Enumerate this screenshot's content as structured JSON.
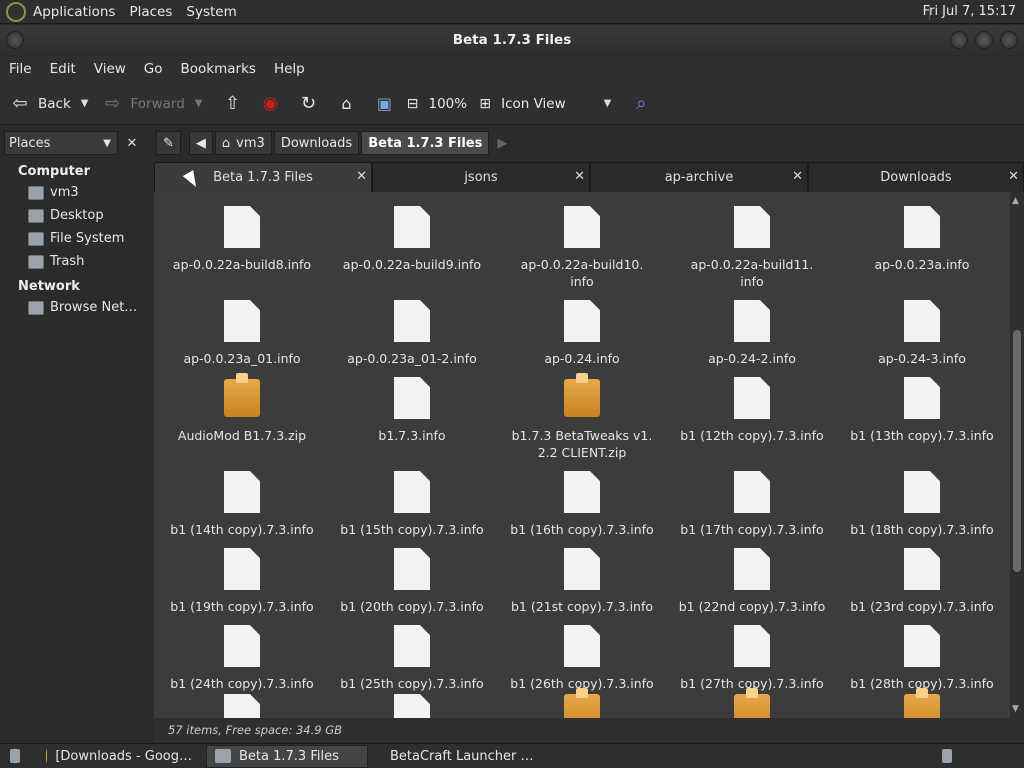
{
  "topbar": {
    "menus": [
      "Applications",
      "Places",
      "System"
    ],
    "clock": "Fri Jul  7, 15:17"
  },
  "window": {
    "title": "Beta 1.7.3 Files"
  },
  "menubar": [
    "File",
    "Edit",
    "View",
    "Go",
    "Bookmarks",
    "Help"
  ],
  "toolbar": {
    "back": "Back",
    "forward": "Forward",
    "zoom": "100%",
    "view_mode": "Icon View"
  },
  "sidebar": {
    "selector": "Places",
    "groups": [
      {
        "label": "Computer",
        "items": [
          "vm3",
          "Desktop",
          "File System",
          "Trash"
        ]
      },
      {
        "label": "Network",
        "items": [
          "Browse Net…"
        ]
      }
    ]
  },
  "pathbar": [
    "vm3",
    "Downloads",
    "Beta 1.7.3 Files"
  ],
  "tabs": [
    "Beta 1.7.3 Files",
    "jsons",
    "ap-archive",
    "Downloads"
  ],
  "files": [
    [
      "ap-0.0.22a-build8.info",
      "file"
    ],
    [
      "ap-0.0.22a-build9.info",
      "file"
    ],
    [
      "ap-0.0.22a-build10.\ninfo",
      "file"
    ],
    [
      "ap-0.0.22a-build11.\ninfo",
      "file"
    ],
    [
      "ap-0.0.23a.info",
      "file"
    ],
    [
      "ap-0.0.23a_01.info",
      "file"
    ],
    [
      "ap-0.0.23a_01-2.info",
      "file"
    ],
    [
      "ap-0.24.info",
      "file"
    ],
    [
      "ap-0.24-2.info",
      "file"
    ],
    [
      "ap-0.24-3.info",
      "file"
    ],
    [
      "AudioMod B1.7.3.zip",
      "zip"
    ],
    [
      "b1.7.3.info",
      "file"
    ],
    [
      "b1.7.3 BetaTweaks v1.\n2.2 CLIENT.zip",
      "zip"
    ],
    [
      "b1 (12th copy).7.3.info",
      "file"
    ],
    [
      "b1 (13th copy).7.3.info",
      "file"
    ],
    [
      "b1 (14th copy).7.3.info",
      "file"
    ],
    [
      "b1 (15th copy).7.3.info",
      "file"
    ],
    [
      "b1 (16th copy).7.3.info",
      "file"
    ],
    [
      "b1 (17th copy).7.3.info",
      "file"
    ],
    [
      "b1 (18th copy).7.3.info",
      "file"
    ],
    [
      "b1 (19th copy).7.3.info",
      "file"
    ],
    [
      "b1 (20th copy).7.3.info",
      "file"
    ],
    [
      "b1 (21st copy).7.3.info",
      "file"
    ],
    [
      "b1 (22nd copy).7.3.info",
      "file"
    ],
    [
      "b1 (23rd copy).7.3.info",
      "file"
    ],
    [
      "b1 (24th copy).7.3.info",
      "file"
    ],
    [
      "b1 (25th copy).7.3.info",
      "file"
    ],
    [
      "b1 (26th copy).7.3.info",
      "file"
    ],
    [
      "b1 (27th copy).7.3.info",
      "file"
    ],
    [
      "b1 (28th copy).7.3.info",
      "file"
    ]
  ],
  "status": "57 items, Free space: 34.9 GB",
  "taskbar": [
    "[Downloads - Goog…",
    "Beta 1.7.3 Files",
    "BetaCraft Launcher …"
  ]
}
